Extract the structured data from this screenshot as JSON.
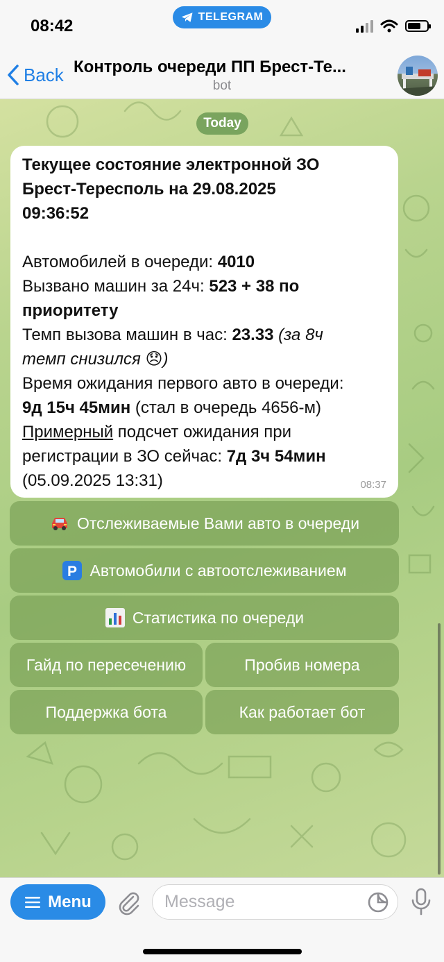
{
  "status_bar": {
    "time": "08:42",
    "telegram_pill": "TELEGRAM"
  },
  "nav": {
    "back_label": "Back",
    "title": "Контроль очереди ПП Брест-Те...",
    "subtitle": "bot"
  },
  "chat": {
    "date_chip": "Today",
    "message": {
      "title_line1": "Текущее состояние электронной ЗО",
      "title_line2": "Брест-Тересполь на 29.08.2025",
      "title_line3": "09:36:52",
      "cars_label": "Автомобилей в очереди: ",
      "cars_value": "4010",
      "called_label": "Вызвано машин за 24ч: ",
      "called_value": "523 + 38 по",
      "called_value2": "приоритету",
      "rate_label": "Темп вызова машин в час: ",
      "rate_value": "23.33",
      "rate_note1": " (за 8ч",
      "rate_note2": "темп снизился ",
      "rate_emoji": "😞",
      "rate_note3": ")",
      "wait_label": "Время ожидания первого авто в очереди:",
      "wait_value": "9д 15ч 45мин",
      "wait_note": " (стал в очередь 4656-м)",
      "approx_word": "Примерный",
      "approx_rest": " подсчет ожидания при",
      "approx_line2": "регистрации в ЗО сейчас: ",
      "approx_value": "7д 3ч 54мин",
      "approx_date": "(05.09.2025 13:31)",
      "time": "08:37"
    }
  },
  "keyboard": {
    "tracked": "Отслеживаемые Вами авто в очереди",
    "auto_tracking": "Автомобили с автоотслеживанием",
    "stats": "Статистика по очереди",
    "guide": "Гайд по пересечению",
    "plate_check": "Пробив номера",
    "support": "Поддержка бота",
    "how_it_works": "Как работает бот",
    "icons": {
      "tracked": "car-icon",
      "auto_tracking": "parking-icon",
      "stats": "bar-chart-icon"
    }
  },
  "input": {
    "menu_label": "Menu",
    "placeholder": "Message"
  },
  "colors": {
    "accent": "#2a8be6",
    "keyboard_button": "#6e964b",
    "bubble": "#ffffff"
  }
}
